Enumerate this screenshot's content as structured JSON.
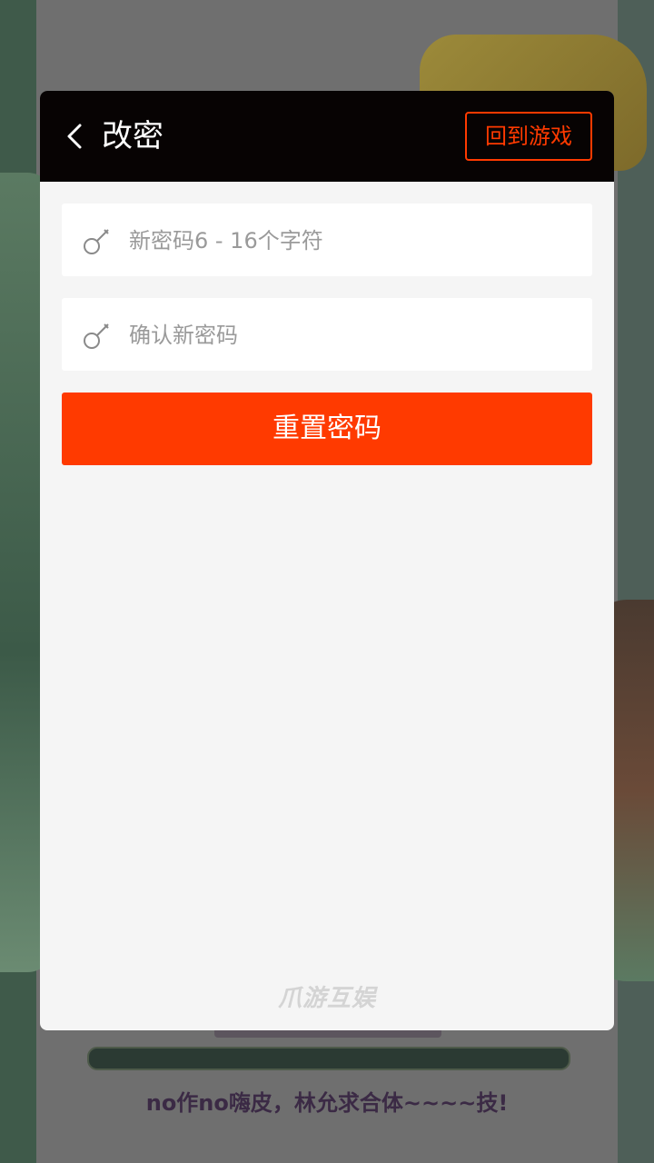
{
  "background": {
    "caption": "no作no嗨皮，林允求合体~~~~技!"
  },
  "header": {
    "title": "改密",
    "return_label": "回到游戏"
  },
  "form": {
    "new_password_placeholder": "新密码6 - 16个字符",
    "confirm_password_placeholder": "确认新密码",
    "submit_label": "重置密码"
  },
  "footer": {
    "brand": "爪游互娱"
  },
  "colors": {
    "accent": "#ff3a00",
    "header_bg": "#070303",
    "panel_bg": "#f5f5f5"
  }
}
